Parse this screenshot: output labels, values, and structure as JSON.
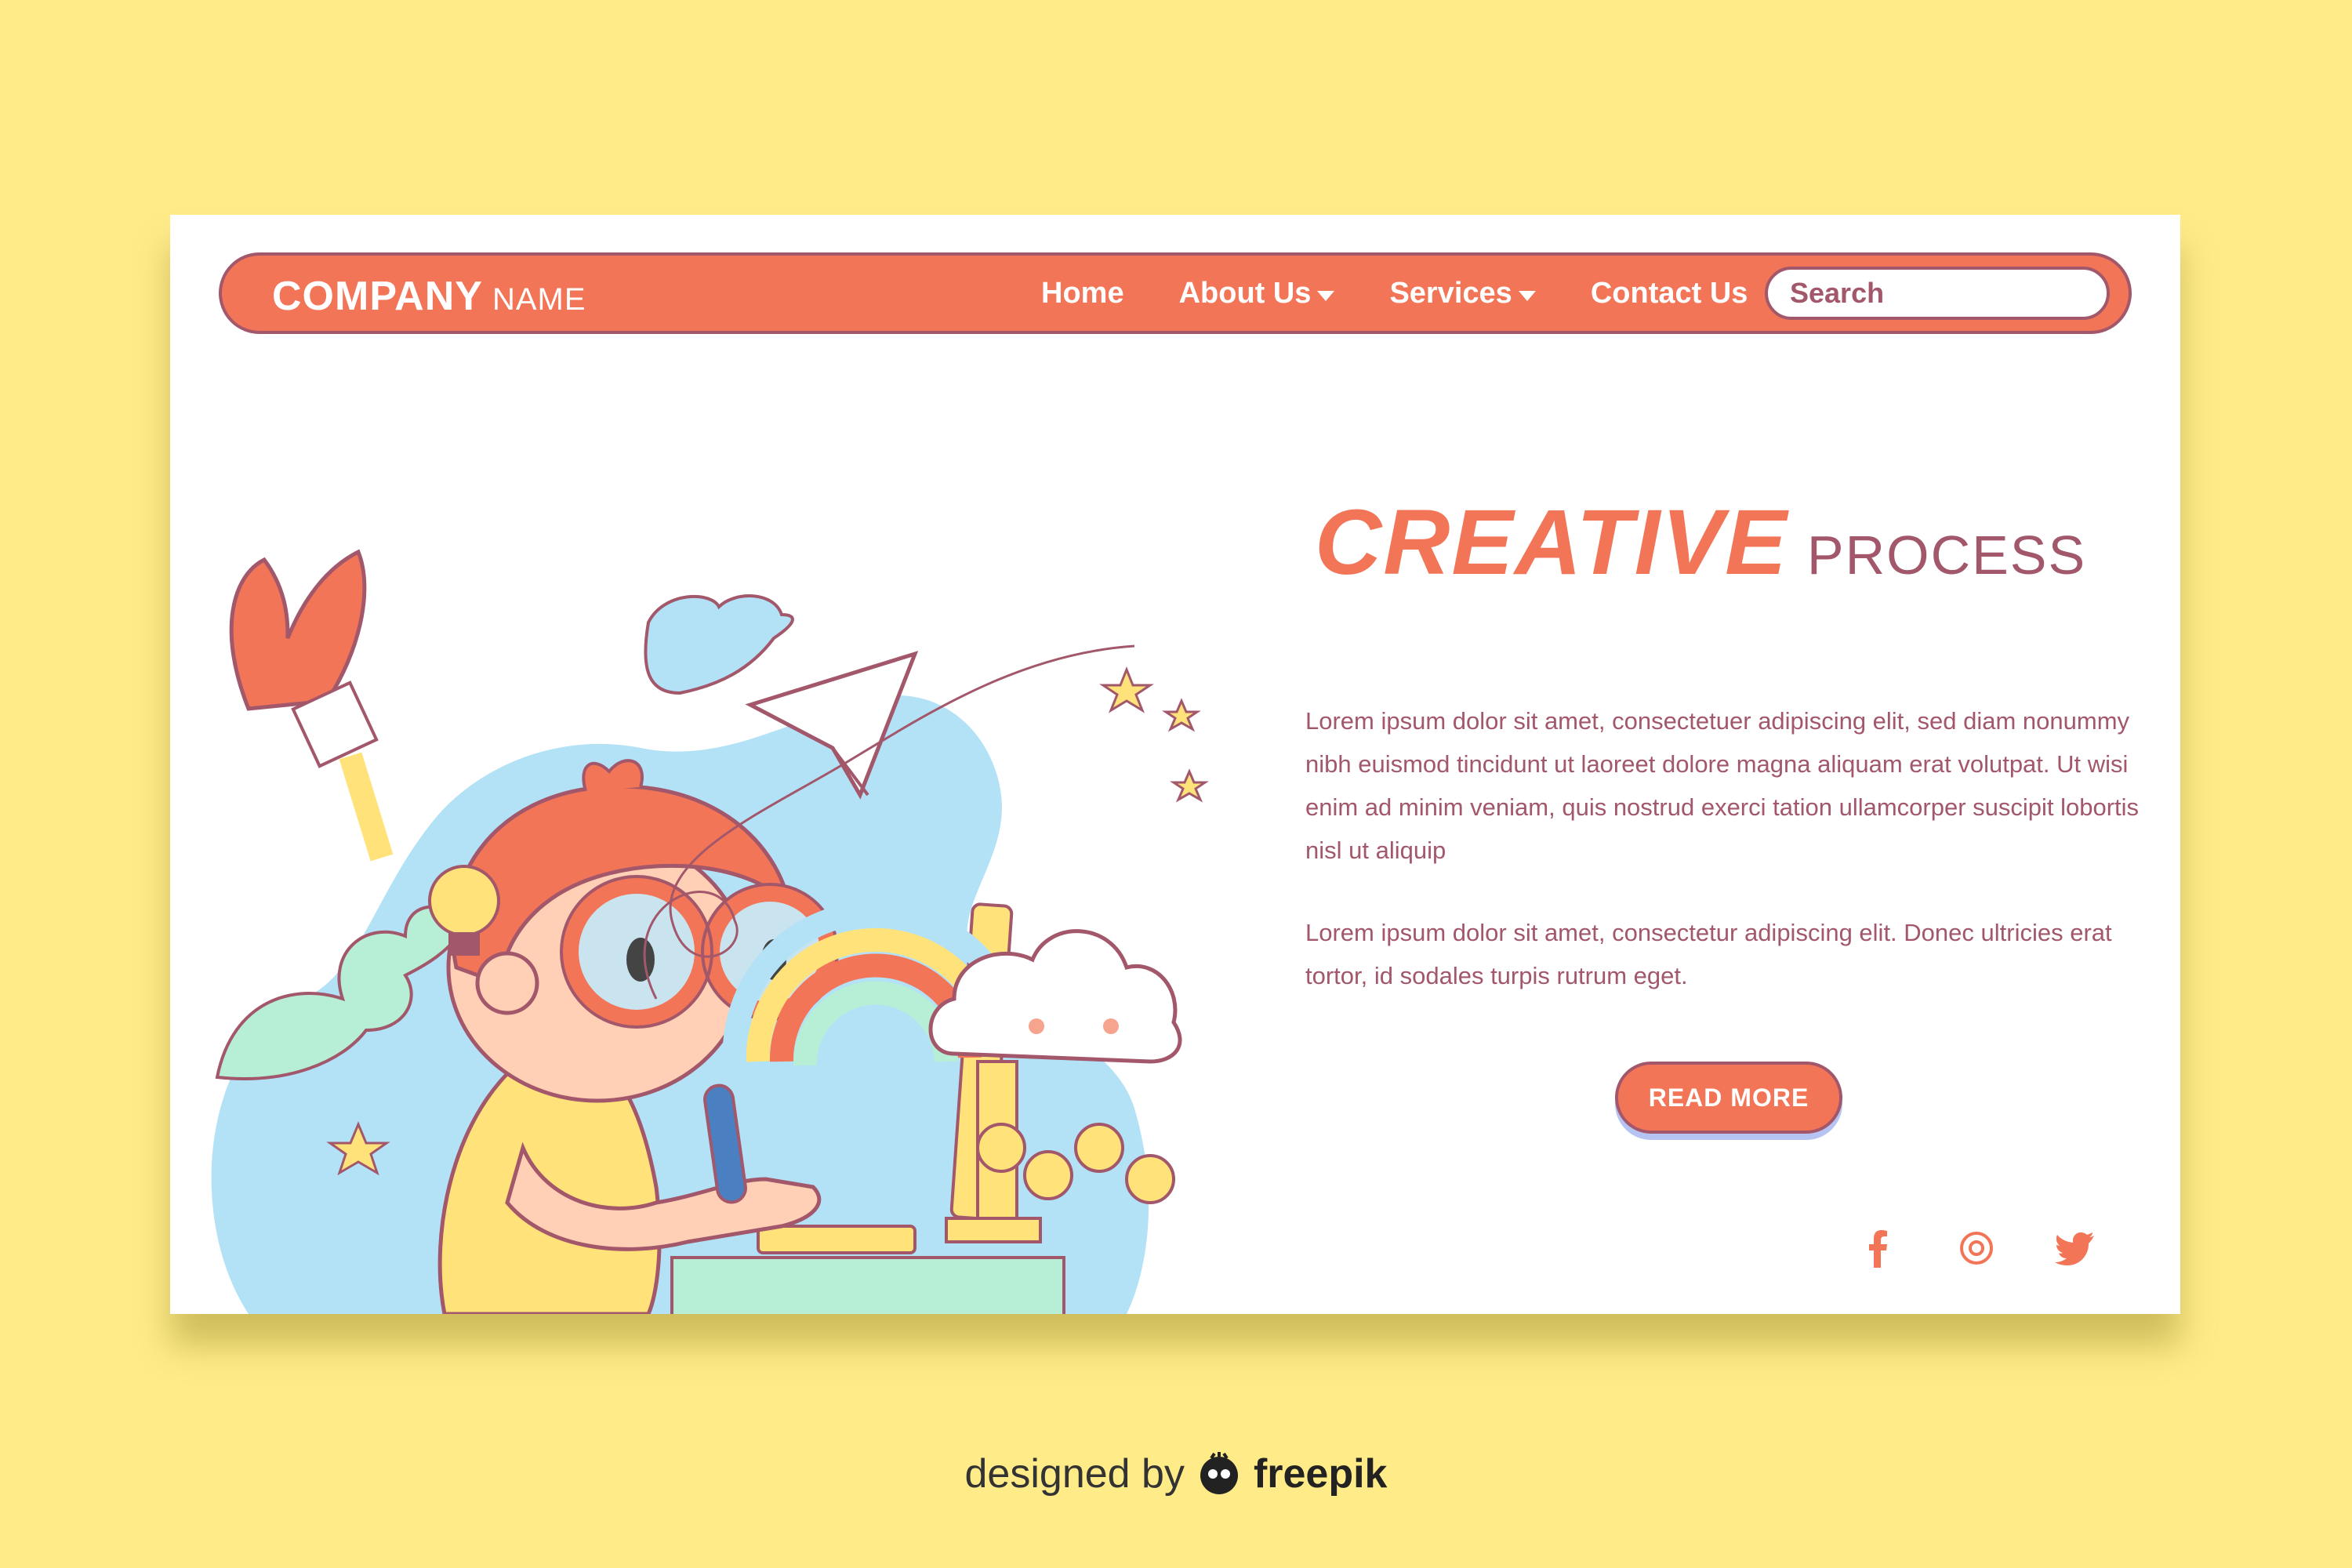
{
  "navbar": {
    "brand_company": "COMPANY",
    "brand_name": "NAME",
    "links": [
      {
        "label": "Home"
      },
      {
        "label": "About Us"
      },
      {
        "label": "Services"
      },
      {
        "label": "Contact Us"
      }
    ],
    "search_placeholder": "Search"
  },
  "hero": {
    "title_primary": "CREATIVE",
    "title_secondary": "PROCESS",
    "paragraph_1": "Lorem ipsum dolor sit amet, consectetuer adipiscing elit, sed diam nonummy nibh euismod tincidunt ut laoreet dolore magna aliquam erat volutpat. Ut wisi enim ad minim veniam, quis nostrud exerci tation ullamcorper suscipit lobortis nisl ut aliquip",
    "paragraph_2": "Lorem ipsum dolor sit amet, consectetur adipiscing elit. Donec ultricies erat tortor, id sodales turpis rutrum eget.",
    "cta_label": "READ MORE"
  },
  "socials": [
    {
      "icon": "facebook-icon"
    },
    {
      "icon": "instagram-icon"
    },
    {
      "icon": "twitter-icon"
    }
  ],
  "credit": {
    "prefix": "designed by",
    "brand": "freepik"
  },
  "colors": {
    "background": "#ffec89",
    "accent": "#f37558",
    "text": "#a2576a",
    "button_shadow": "#b5c4f2"
  }
}
